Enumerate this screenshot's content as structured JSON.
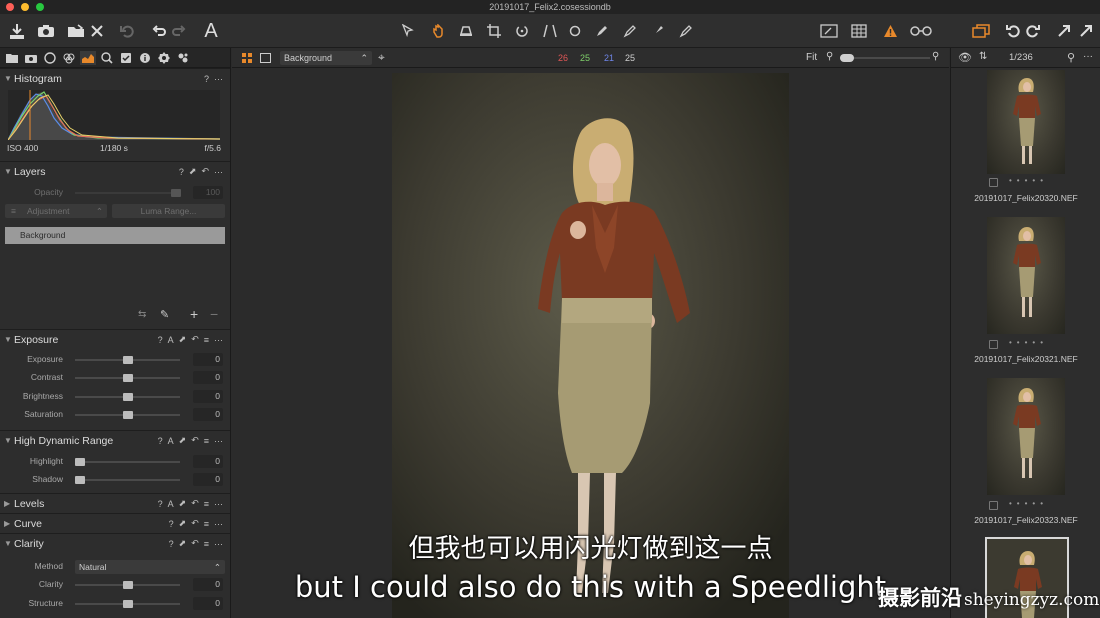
{
  "window": {
    "title": "20191017_Felix2.cosessiondb"
  },
  "viewbar": {
    "layer_select": "Background",
    "r": "26",
    "g": "25",
    "b": "21",
    "a": "25",
    "zoom": "Fit"
  },
  "histogram": {
    "title": "Histogram",
    "iso": "ISO 400",
    "shutter": "1/180 s",
    "aperture": "f/5.6"
  },
  "layers": {
    "title": "Layers",
    "opacity_label": "Opacity",
    "opacity_value": "100",
    "adjustment_btn": "Adjustment",
    "luma_btn": "Luma Range...",
    "layer_name": "Background"
  },
  "exposure": {
    "title": "Exposure",
    "rows": [
      {
        "label": "Exposure",
        "value": "0"
      },
      {
        "label": "Contrast",
        "value": "0"
      },
      {
        "label": "Brightness",
        "value": "0"
      },
      {
        "label": "Saturation",
        "value": "0"
      }
    ]
  },
  "hdr": {
    "title": "High Dynamic Range",
    "rows": [
      {
        "label": "Highlight",
        "value": "0"
      },
      {
        "label": "Shadow",
        "value": "0"
      }
    ]
  },
  "levels": {
    "title": "Levels"
  },
  "curve": {
    "title": "Curve"
  },
  "clarity": {
    "title": "Clarity",
    "method_label": "Method",
    "method_value": "Natural",
    "rows": [
      {
        "label": "Clarity",
        "value": "0"
      },
      {
        "label": "Structure",
        "value": "0"
      }
    ]
  },
  "browser": {
    "counter": "1/236",
    "items": [
      {
        "name": "20191017_Felix20320.NEF"
      },
      {
        "name": "20191017_Felix20321.NEF"
      },
      {
        "name": "20191017_Felix20323.NEF"
      }
    ]
  },
  "subtitle": {
    "zh": "但我也可以用闪光灯做到这一点",
    "en": "but I could also do this with a Speedlight"
  },
  "watermark": {
    "cn": "摄影前沿",
    "url": "sheyingzyz.com"
  },
  "colors": {
    "accent": "#e8892b",
    "warning": "#e8892b",
    "red": "#e05656",
    "green": "#7fcf6a",
    "blue": "#6f86e8"
  }
}
